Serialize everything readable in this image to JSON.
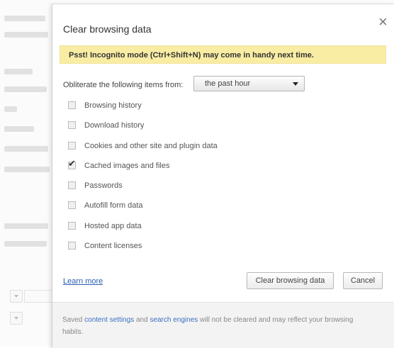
{
  "dialog": {
    "title": "Clear browsing data",
    "close_icon": "close-icon",
    "banner": "Psst! Incognito mode (Ctrl+Shift+N) may come in handy next time.",
    "obliterate_label": "Obliterate the following items from:",
    "time_range_selected": "the past hour",
    "items": [
      {
        "label": "Browsing history",
        "checked": false
      },
      {
        "label": "Download history",
        "checked": false
      },
      {
        "label": "Cookies and other site and plugin data",
        "checked": false
      },
      {
        "label": "Cached images and files",
        "checked": true
      },
      {
        "label": "Passwords",
        "checked": false
      },
      {
        "label": "Autofill form data",
        "checked": false
      },
      {
        "label": "Hosted app data",
        "checked": false
      },
      {
        "label": "Content licenses",
        "checked": false
      }
    ],
    "learn_more": "Learn more",
    "clear_button": "Clear browsing data",
    "cancel_button": "Cancel",
    "footer": {
      "prefix": "Saved ",
      "link1": "content settings",
      "middle": " and ",
      "link2": "search engines",
      "suffix": " will not be cleared and may reflect your browsing habits."
    }
  }
}
